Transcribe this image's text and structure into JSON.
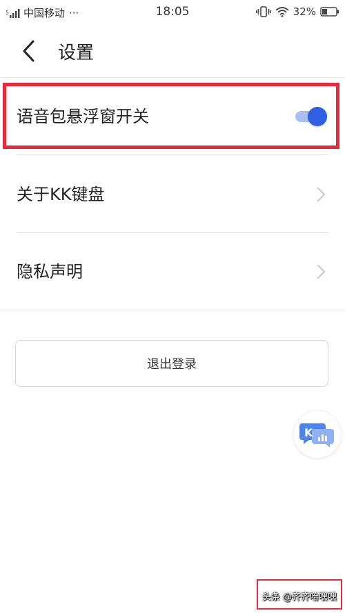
{
  "status_bar": {
    "carrier": "中国移动",
    "carrier_more": "···",
    "time": "18:05",
    "battery_percent": "32%",
    "icons": [
      "signal-icon",
      "vibrate-icon",
      "wifi-icon",
      "battery-icon"
    ]
  },
  "header": {
    "title": "设置",
    "back_icon": "chevron-left-icon"
  },
  "settings": {
    "voice_float_toggle": {
      "label": "语音包悬浮窗开关",
      "enabled": true
    },
    "about": {
      "label": "关于KK键盘"
    },
    "privacy": {
      "label": "隐私声明"
    }
  },
  "logout": {
    "label": "退出登录"
  },
  "floating_button": {
    "icon": "kk-voice-icon"
  },
  "watermark": {
    "text": "头条 @齐齐哈嘿嘿"
  },
  "colors": {
    "accent": "#2f5fe3",
    "highlight": "#e8293b",
    "toggle_track": "#a9bff2"
  }
}
